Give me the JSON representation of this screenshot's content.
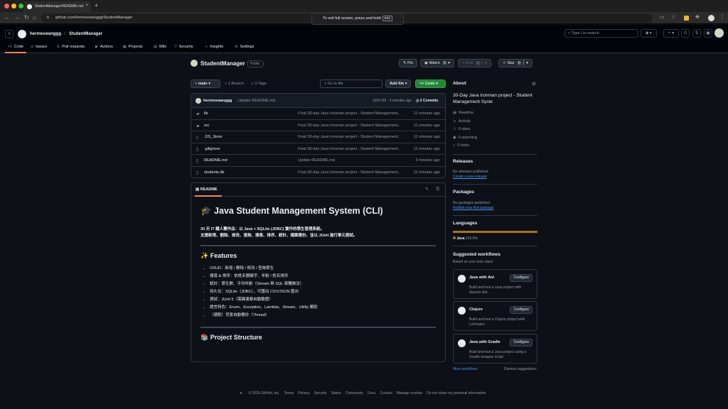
{
  "browser": {
    "tab_title": "StudentManager/README.md",
    "url": "github.com/hermeswanggg/StudentManager",
    "fullscreen_toast": "To exit full screen, press and hold",
    "fullscreen_key": "esc"
  },
  "header": {
    "owner": "hermeswanggg",
    "separator": "/",
    "repo": "StudentManager",
    "search_placeholder": "Type / to search",
    "tabs": [
      "Code",
      "Issues",
      "Pull requests",
      "Actions",
      "Projects",
      "Wiki",
      "Security",
      "Insights",
      "Settings"
    ]
  },
  "repo": {
    "name": "StudentManager",
    "visibility": "Public",
    "pin": "Pin",
    "watch": "Watch",
    "watch_count": "0",
    "fork": "Fork",
    "fork_count": "0",
    "star": "Star",
    "star_count": "0",
    "branch": "main",
    "branch_count": "1 Branch",
    "tag_count": "0 Tags",
    "goto_placeholder": "Go to file",
    "add_file": "Add file",
    "code_button": "Code"
  },
  "commit": {
    "author": "hermeswanggg",
    "message": "Update README.md",
    "hash_time": "1d37c95 · 3 minutes ago",
    "commits": "2 Commits"
  },
  "files": [
    {
      "icon": "folder",
      "name": "lib",
      "msg": "Final 30-day Java Ironman project - Student Management...",
      "time": "11 minutes ago"
    },
    {
      "icon": "folder",
      "name": "src",
      "msg": "Final 30-day Java Ironman project - Student Management...",
      "time": "11 minutes ago"
    },
    {
      "icon": "file",
      "name": ".DS_Store",
      "msg": "Final 30-day Java Ironman project - Student Management...",
      "time": "11 minutes ago"
    },
    {
      "icon": "file",
      "name": ".gitignore",
      "msg": "Final 30-day Java Ironman project - Student Management...",
      "time": "11 minutes ago"
    },
    {
      "icon": "file",
      "name": "README.md",
      "msg": "Update README.md",
      "time": "3 minutes ago"
    },
    {
      "icon": "file",
      "name": "students.db",
      "msg": "Final 30-day Java Ironman project - Student Management...",
      "time": "11 minutes ago"
    }
  ],
  "readme": {
    "tab": "README",
    "title": "🎓 Java Student Management System (CLI)",
    "intro1": "30 天 IT 鐵人賽作品：以 Java + SQLite (JDBC) 實作的學生管理系統。",
    "intro2": "支援新增、刪除、修改、查詢、搜尋、排序、統計、檔案備份，並以 JUnit 進行單元測試。",
    "features_heading": "✨ Features",
    "features": [
      "CRUD：新增 / 刪除 / 修改 / 查詢學生",
      "搜尋 & 排序：依姓名關鍵字、年齡 / 姓名排序",
      "統計：學生數、平均年齡（Stream 與 SQL 兩種做法）",
      "持久化：SQLite（JDBC），可匯出 CSV/JSON 匯出",
      "測試：JUnit 5（需鍵連鎖自動驗證）",
      "語言特色：Enum、Exception、Lambda、Stream、Utility 類別",
      "（選配）背景自動備份（Thread）"
    ],
    "structure_heading": "📚 Project Structure"
  },
  "sidebar": {
    "about": "About",
    "description": "30-Day Java Ironman project - Student Management Syste",
    "readme": "Readme",
    "activity": "Activity",
    "stars": "0 stars",
    "watching": "0 watching",
    "forks": "0 forks",
    "releases": "Releases",
    "no_releases": "No releases published",
    "create_release": "Create a new release",
    "packages": "Packages",
    "no_packages": "No packages published",
    "publish_package": "Publish your first package",
    "languages": "Languages",
    "lang_name": "Java",
    "lang_pct": "100.0%",
    "lang_fraction": 1.0,
    "lang_color": "#b07219",
    "suggested": "Suggested workflows",
    "based_on": "Based on your tech stack",
    "workflows": [
      {
        "name": "Java with Ant",
        "desc": "Build and test a Java project with Apache Ant.",
        "configure": "Configure"
      },
      {
        "name": "Clojure",
        "desc": "Build and test a Clojure project with Leiningen.",
        "configure": "Configure"
      },
      {
        "name": "Java with Gradle",
        "desc": "Build and test a Java project using a Gradle wrapper script.",
        "configure": "Configure"
      }
    ],
    "more_workflows": "More workflows",
    "dismiss": "Dismiss suggestions"
  },
  "footer": [
    "© 2025 GitHub, Inc.",
    "Terms",
    "Privacy",
    "Security",
    "Status",
    "Community",
    "Docs",
    "Contact",
    "Manage cookies",
    "Do not share my personal information"
  ]
}
